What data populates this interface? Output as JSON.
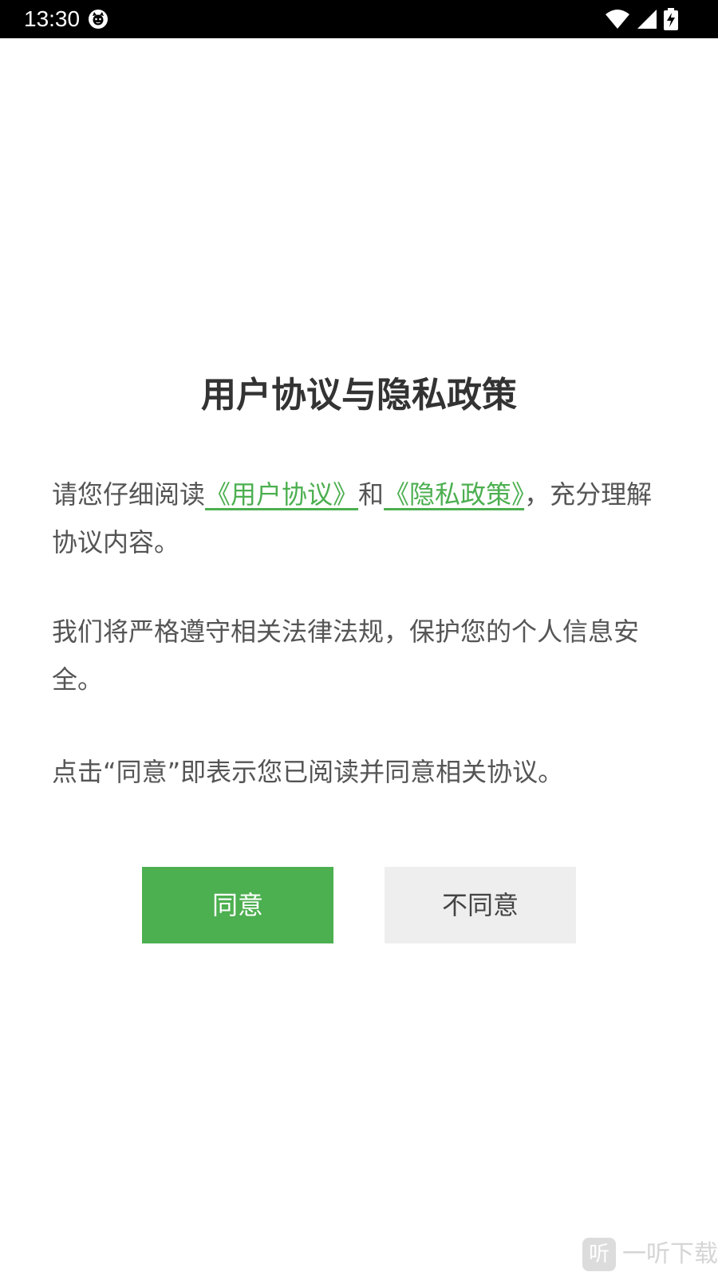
{
  "status_bar": {
    "time": "13:30"
  },
  "dialog": {
    "title": "用户协议与隐私政策",
    "p1": {
      "prefix": "请您仔细阅读",
      "link_user_agreement": "《用户协议》",
      "and": "和",
      "link_privacy_policy": "《隐私政策》",
      "suffix": "，充分理解协议内容。"
    },
    "p2": "我们将严格遵守相关法律法规，保护您的个人信息安全。",
    "p3": "点击“同意”即表示您已阅读并同意相关协议。"
  },
  "buttons": {
    "agree": "同意",
    "disagree": "不同意"
  },
  "watermark": {
    "logo_char": "听",
    "text": "一听下载"
  },
  "colors": {
    "accent_green": "#4caf50",
    "disagree_bg": "#eeeeee",
    "status_bar_bg": "#000000"
  }
}
